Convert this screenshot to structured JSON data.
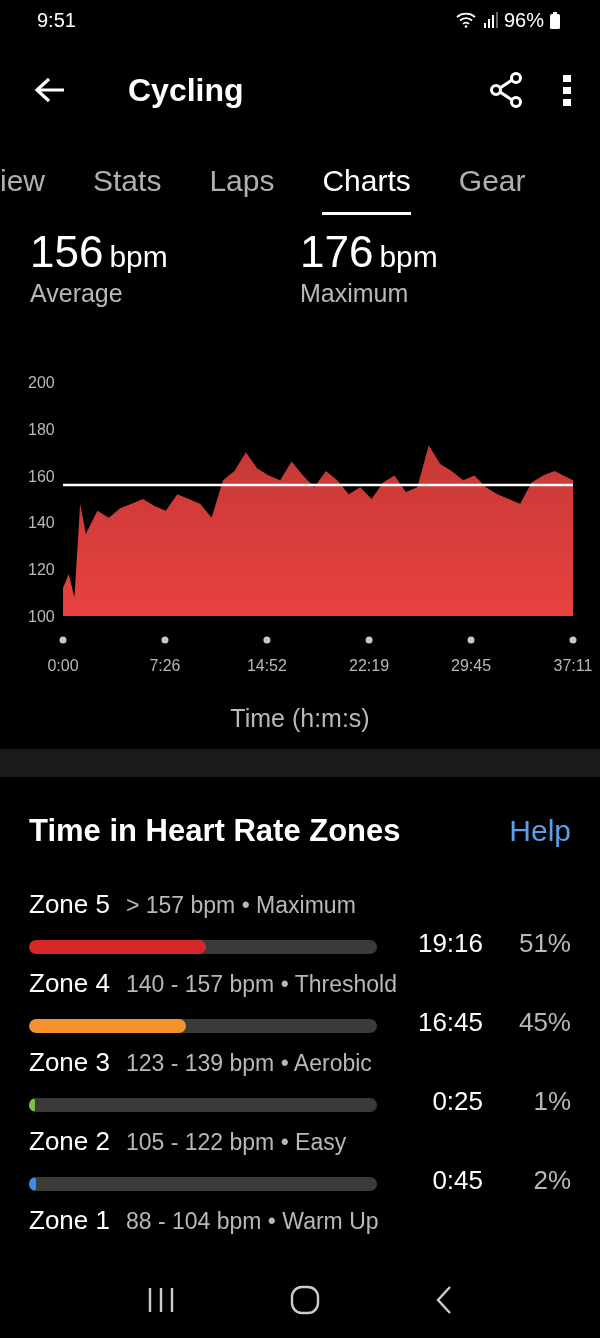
{
  "status_bar": {
    "time": "9:51",
    "battery": "96%"
  },
  "app_bar": {
    "title": "Cycling"
  },
  "tabs": [
    {
      "label": "iew",
      "selected": false
    },
    {
      "label": "Stats",
      "selected": false
    },
    {
      "label": "Laps",
      "selected": false
    },
    {
      "label": "Charts",
      "selected": true
    },
    {
      "label": "Gear",
      "selected": false
    }
  ],
  "summary": [
    {
      "value": "156",
      "unit": "bpm",
      "label": "Average"
    },
    {
      "value": "176",
      "unit": "bpm",
      "label": "Maximum"
    }
  ],
  "heart_rate_chart": {
    "chart_data": {
      "type": "area",
      "xlabel": "Time (h:m:s)",
      "ylim": [
        100,
        200
      ],
      "yticks": [
        100,
        120,
        140,
        160,
        180,
        200
      ],
      "xlim": [
        0,
        2231
      ],
      "xticks": [
        {
          "value": 0,
          "label": "0:00"
        },
        {
          "value": 446,
          "label": "7:26"
        },
        {
          "value": 892,
          "label": "14:52"
        },
        {
          "value": 1339,
          "label": "22:19"
        },
        {
          "value": 1785,
          "label": "29:45"
        },
        {
          "value": 2231,
          "label": "37:11"
        }
      ],
      "x": [
        0,
        25,
        50,
        75,
        100,
        150,
        200,
        250,
        300,
        350,
        400,
        450,
        500,
        550,
        600,
        650,
        700,
        750,
        800,
        850,
        900,
        950,
        1000,
        1050,
        1100,
        1150,
        1200,
        1250,
        1300,
        1350,
        1400,
        1450,
        1500,
        1550,
        1600,
        1650,
        1700,
        1750,
        1800,
        1850,
        1900,
        1950,
        2000,
        2050,
        2100,
        2150,
        2231
      ],
      "series": [
        {
          "color": "#e8423f",
          "values": [
            112,
            118,
            108,
            148,
            135,
            145,
            142,
            146,
            148,
            150,
            147,
            145,
            152,
            150,
            148,
            142,
            158,
            162,
            170,
            163,
            160,
            158,
            166,
            160,
            155,
            162,
            158,
            152,
            155,
            150,
            157,
            160,
            153,
            155,
            173,
            165,
            162,
            158,
            160,
            155,
            152,
            150,
            148,
            157,
            160,
            162,
            158
          ]
        }
      ],
      "ref_lines": [
        {
          "axis": "y",
          "value": 156
        }
      ]
    }
  },
  "zones_section": {
    "title": "Time in Heart Rate Zones",
    "help": "Help"
  },
  "zones": [
    {
      "name": "Zone 5",
      "range": "> 157 bpm • Maximum",
      "time": "19:16",
      "percent": "51%",
      "level": 0.51,
      "color": "#d62828"
    },
    {
      "name": "Zone 4",
      "range": "140 - 157 bpm • Threshold",
      "time": "16:45",
      "percent": "45%",
      "level": 0.45,
      "color": "#f5922e"
    },
    {
      "name": "Zone 3",
      "range": "123 - 139 bpm • Aerobic",
      "time": "0:25",
      "percent": "1%",
      "level": 0.01,
      "color": "#7cc242"
    },
    {
      "name": "Zone 2",
      "range": "105 - 122 bpm • Easy",
      "time": "0:45",
      "percent": "2%",
      "level": 0.02,
      "color": "#3a8ee6"
    },
    {
      "name": "Zone 1",
      "range": "88 - 104 bpm • Warm Up"
    }
  ]
}
